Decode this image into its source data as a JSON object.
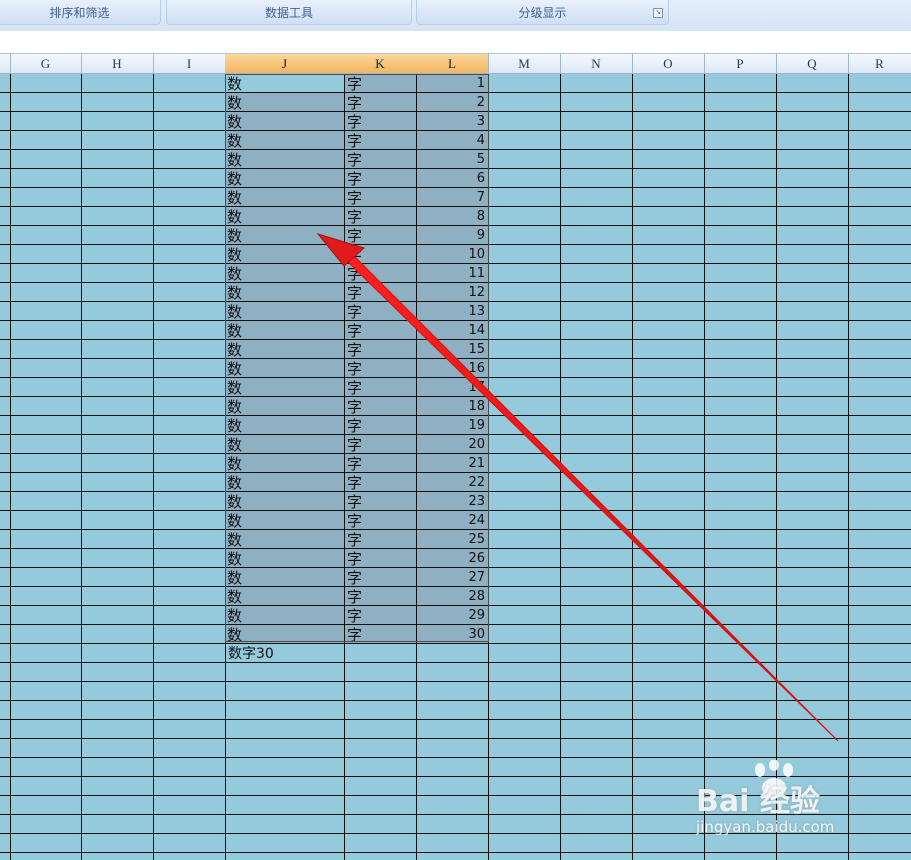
{
  "ribbon": {
    "groups": [
      {
        "label": "排序和筛选"
      },
      {
        "label": "数据工具"
      },
      {
        "label": "分级显示"
      }
    ],
    "launcher_icon": "dialog-launcher-icon"
  },
  "sheet": {
    "columns": [
      "G",
      "H",
      "I",
      "J",
      "K",
      "L",
      "M",
      "N",
      "O",
      "P",
      "Q",
      "R"
    ],
    "selected_columns": [
      "J",
      "K",
      "L"
    ],
    "column_J": [
      "数",
      "数",
      "数",
      "数",
      "数",
      "数",
      "数",
      "数",
      "数",
      "数",
      "数",
      "数",
      "数",
      "数",
      "数",
      "数",
      "数",
      "数",
      "数",
      "数",
      "数",
      "数",
      "数",
      "数",
      "数",
      "数",
      "数",
      "数",
      "数",
      "数"
    ],
    "column_K": [
      "字",
      "字",
      "字",
      "字",
      "字",
      "字",
      "字",
      "字",
      "字",
      "字",
      "字",
      "字",
      "字",
      "字",
      "字",
      "字",
      "字",
      "字",
      "字",
      "字",
      "字",
      "字",
      "字",
      "字",
      "字",
      "字",
      "字",
      "字",
      "字",
      "字"
    ],
    "column_L": [
      "1",
      "2",
      "3",
      "4",
      "5",
      "6",
      "7",
      "8",
      "9",
      "10",
      "11",
      "12",
      "13",
      "14",
      "15",
      "16",
      "17",
      "18",
      "19",
      "20",
      "21",
      "22",
      "23",
      "24",
      "25",
      "26",
      "27",
      "28",
      "29",
      "30"
    ],
    "j31": "数字30"
  },
  "colors": {
    "grid_background": "#94cadb",
    "selection": "#8fafc2",
    "header_selected": "#f2b560",
    "arrow": "#e01b1b"
  },
  "annotation": {
    "type": "red-arrow",
    "icon": "arrow-icon"
  },
  "watermark": {
    "brand": "Bai 经验",
    "url": "jingyan.baidu.com"
  }
}
